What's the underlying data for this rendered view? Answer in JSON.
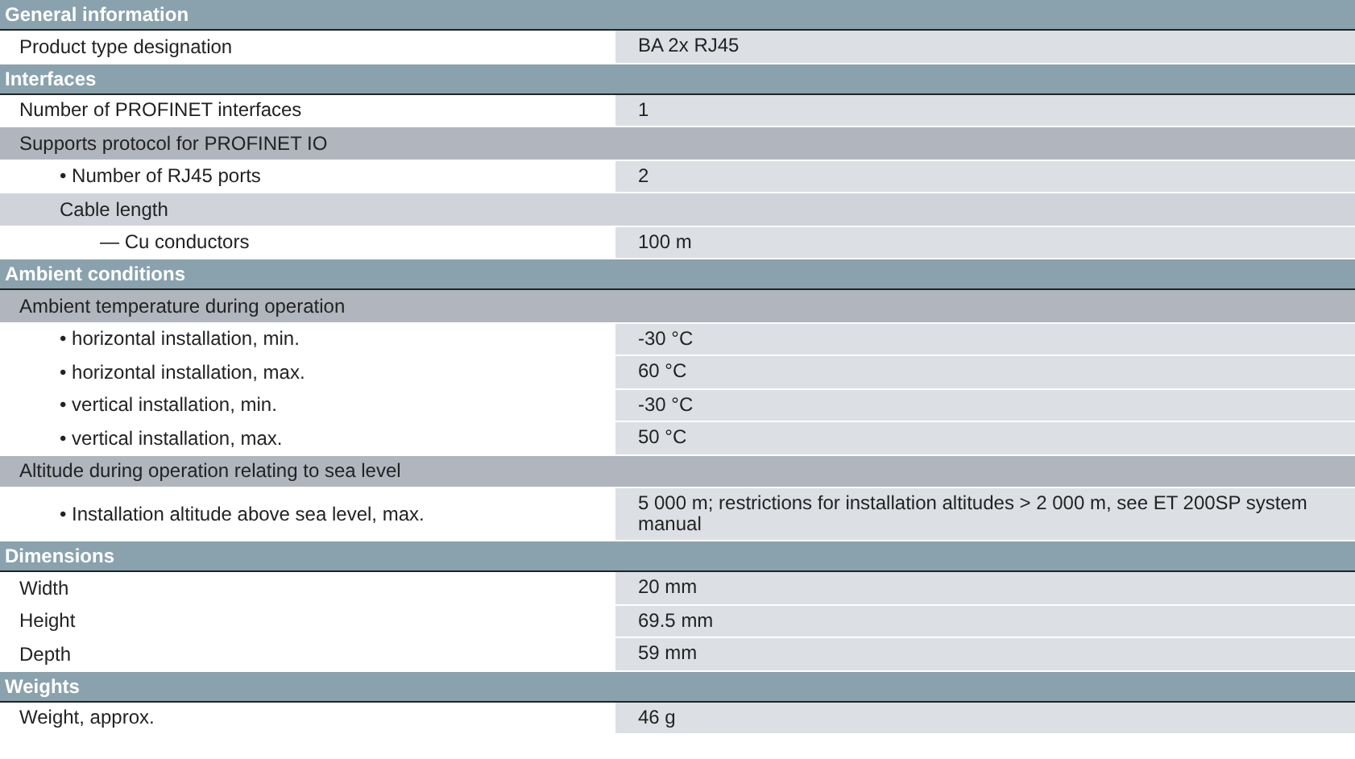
{
  "sections": [
    {
      "title": "General information",
      "rows": [
        {
          "kind": "item",
          "label": "Product type designation",
          "value": "BA 2x RJ45"
        }
      ]
    },
    {
      "title": "Interfaces",
      "rows": [
        {
          "kind": "item",
          "label": "Number of PROFINET interfaces",
          "value": "1"
        },
        {
          "kind": "group",
          "label": "Supports protocol for PROFINET IO",
          "children": [
            {
              "kind": "item",
              "label": "• Number of RJ45 ports",
              "value": "2"
            },
            {
              "kind": "group",
              "label": "Cable length",
              "children": [
                {
                  "kind": "item",
                  "label": "— Cu conductors",
                  "value": "100 m"
                }
              ]
            }
          ]
        }
      ]
    },
    {
      "title": "Ambient conditions",
      "rows": [
        {
          "kind": "group",
          "label": "Ambient temperature during operation",
          "children": [
            {
              "kind": "item",
              "label": "• horizontal installation, min.",
              "value": "-30 °C"
            },
            {
              "kind": "item",
              "label": "• horizontal installation, max.",
              "value": "60 °C"
            },
            {
              "kind": "item",
              "label": "• vertical installation, min.",
              "value": "-30 °C"
            },
            {
              "kind": "item",
              "label": "• vertical installation, max.",
              "value": "50 °C"
            }
          ]
        },
        {
          "kind": "group",
          "label": "Altitude during operation relating to sea level",
          "children": [
            {
              "kind": "item",
              "label": "• Installation altitude above sea level, max.",
              "value": "5 000 m; restrictions for installation altitudes > 2 000 m, see ET 200SP system manual"
            }
          ]
        }
      ]
    },
    {
      "title": "Dimensions",
      "rows": [
        {
          "kind": "item",
          "label": "Width",
          "value": "20 mm"
        },
        {
          "kind": "item",
          "label": "Height",
          "value": "69.5 mm"
        },
        {
          "kind": "item",
          "label": "Depth",
          "value": "59 mm"
        }
      ]
    },
    {
      "title": "Weights",
      "rows": [
        {
          "kind": "item",
          "label": "Weight, approx.",
          "value": "46 g"
        }
      ]
    }
  ]
}
